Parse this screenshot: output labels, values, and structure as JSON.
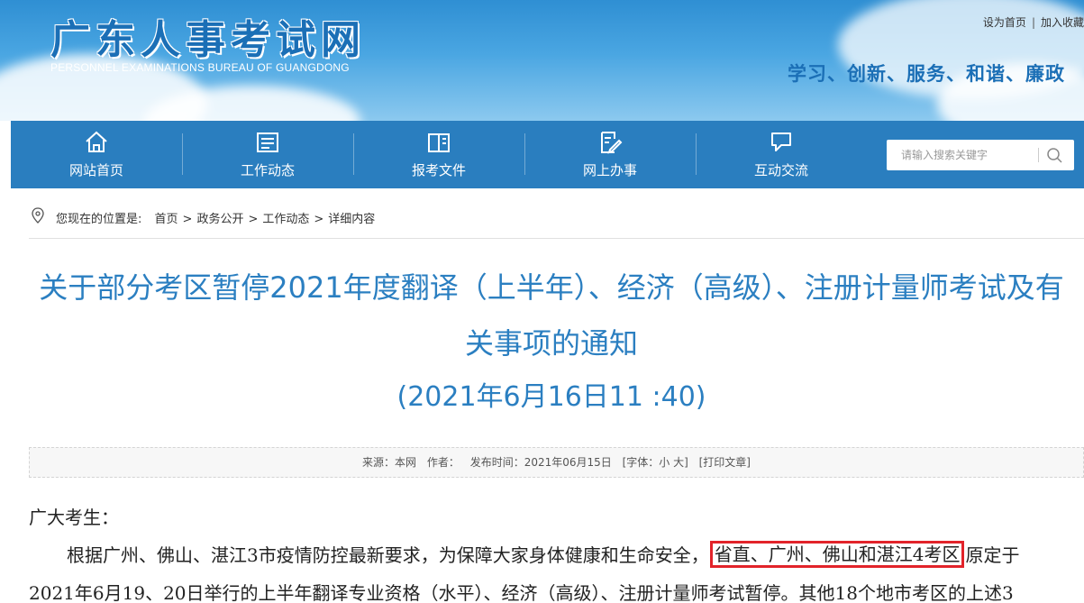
{
  "header": {
    "logo_cn": "广东人事考试网",
    "logo_en": "PERSONNEL EXAMINATIONS BUREAU OF GUANGDONG",
    "links": [
      "设为首页",
      "加入收藏"
    ],
    "link_sep": "|",
    "slogan": "学习、创新、服务、和谐、廉政"
  },
  "nav": {
    "items": [
      {
        "label": "网站首页",
        "icon": "home-icon"
      },
      {
        "label": "工作动态",
        "icon": "news-icon"
      },
      {
        "label": "报考文件",
        "icon": "document-icon"
      },
      {
        "label": "网上办事",
        "icon": "edit-icon"
      },
      {
        "label": "互动交流",
        "icon": "chat-icon"
      }
    ],
    "search": {
      "placeholder": "请输入搜索关键字",
      "icon": "search-icon"
    }
  },
  "breadcrumb": {
    "prefix": "您现在的位置是:",
    "items": [
      "首页",
      "政务公开",
      "工作动态",
      "详细内容"
    ],
    "sep": ">"
  },
  "article": {
    "title": "关于部分考区暂停2021年度翻译（上半年）、经济（高级）、注册计量师考试及有关事项的通知",
    "date": "(2021年6月16日11 :40)",
    "meta": {
      "source": "来源：本网",
      "author": "作者：",
      "published": "发布时间：2021年06月15日",
      "font_size": "[字体：小 大]",
      "print": "[打印文章]"
    },
    "greeting": "广大考生：",
    "p1_before": "根据广州、佛山、湛江3市疫情防控最新要求，为保障大家身体健康和生命安全，",
    "p1_highlight": "省直、广州、佛山和湛江4考区",
    "p1_after": "原定于",
    "p2": "2021年6月19、20日举行的上半年翻译专业资格（水平）、经济（高级）、注册计量师考试暂停。其他18个地市考区的上述3",
    "highlight_color": "#e2232a"
  }
}
